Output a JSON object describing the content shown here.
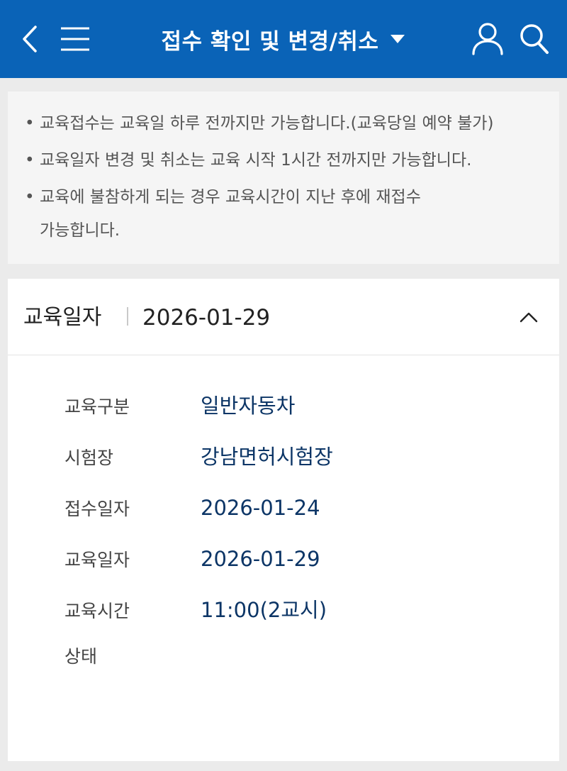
{
  "header": {
    "title": "접수 확인 및 변경/취소",
    "bg_color": "#0a63b7",
    "icons": [
      "back-arrow-icon",
      "hamburger-menu-icon",
      "caret-down-icon",
      "user-icon",
      "search-icon"
    ]
  },
  "notice": {
    "bullet": "•",
    "items": [
      "교육접수는 교육일 하루 전까지만 가능합니다.(교육당일 예약 불가)",
      "교육일자 변경 및 취소는 교육 시작 1시간 전까지만 가능합니다.",
      "교육에 불참하게 되는 경우 교육시간이 지난 후에 재접수",
      "가능합니다."
    ]
  },
  "reservation": {
    "head_label": "교육일자",
    "head_value": "2026-01-29",
    "value_color": "#0c3566",
    "rows": [
      {
        "label": "교육구분",
        "value": "일반자동차"
      },
      {
        "label": "시험장",
        "value": "강남면허시험장"
      },
      {
        "label": "접수일자",
        "value": "2026-01-24"
      },
      {
        "label": "교육일자",
        "value": "2026-01-29"
      },
      {
        "label": "교육시간",
        "value": "11:00(2교시)"
      },
      {
        "label": "상태",
        "value": ""
      }
    ]
  }
}
